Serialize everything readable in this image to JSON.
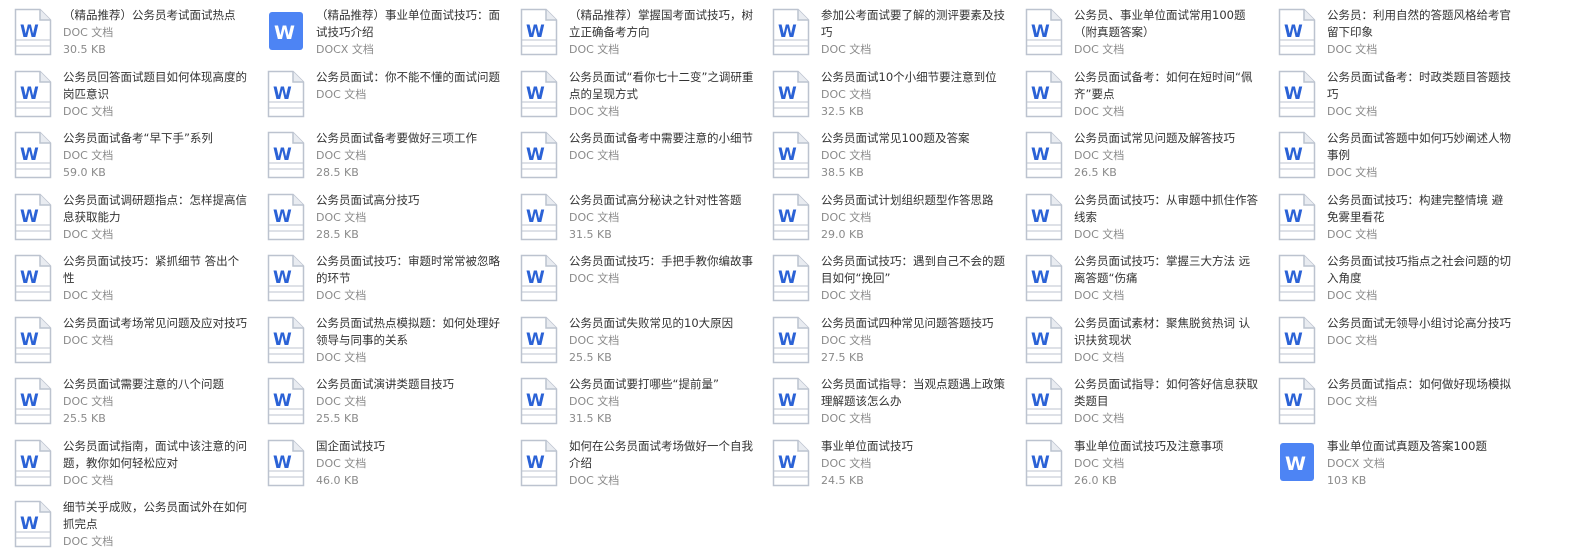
{
  "colors": {
    "doc_icon_outline": "#bcc3cf",
    "doc_icon_fold": "#e9ecf1",
    "doc_w_blue": "#2b62d6",
    "docx_icon_fill": "#4d84f4",
    "title_text": "#333333",
    "meta_text": "#8a8a8a"
  },
  "files": [
    {
      "title": "（精品推荐）公务员考试面试热点",
      "type": "DOC 文档",
      "size": "30.5 KB",
      "icon": "doc-icon"
    },
    {
      "title": "（精品推荐）事业单位面试技巧：面试技巧介绍",
      "type": "DOCX 文档",
      "size": "",
      "icon": "docx-icon"
    },
    {
      "title": "（精品推荐）掌握国考面试技巧，树立正确备考方向",
      "type": "DOC 文档",
      "size": "",
      "icon": "doc-icon"
    },
    {
      "title": "参加公考面试要了解的测评要素及技巧",
      "type": "DOC 文档",
      "size": "",
      "icon": "doc-icon"
    },
    {
      "title": "公务员、事业单位面试常用100题（附真题答案）",
      "type": "DOC 文档",
      "size": "",
      "icon": "doc-icon"
    },
    {
      "title": "公务员：利用自然的答题风格给考官留下印象",
      "type": "DOC 文档",
      "size": "",
      "icon": "doc-icon"
    },
    {
      "title": "公务员回答面试题目如何体现高度的岗匹意识",
      "type": "DOC 文档",
      "size": "",
      "icon": "doc-icon"
    },
    {
      "title": "公务员面试：你不能不懂的面试问题",
      "type": "DOC 文档",
      "size": "",
      "icon": "doc-icon"
    },
    {
      "title": "公务员面试“看你七十二变”之调研重点的呈现方式",
      "type": "DOC 文档",
      "size": "",
      "icon": "doc-icon"
    },
    {
      "title": "公务员面试10个小细节要注意到位",
      "type": "DOC 文档",
      "size": "32.5 KB",
      "icon": "doc-icon"
    },
    {
      "title": "公务员面试备考：如何在短时间“佩齐”要点",
      "type": "DOC 文档",
      "size": "",
      "icon": "doc-icon"
    },
    {
      "title": "公务员面试备考：时政类题目答题技巧",
      "type": "DOC 文档",
      "size": "",
      "icon": "doc-icon"
    },
    {
      "title": "公务员面试备考“早下手”系列",
      "type": "DOC 文档",
      "size": "59.0 KB",
      "icon": "doc-icon"
    },
    {
      "title": "公务员面试备考要做好三项工作",
      "type": "DOC 文档",
      "size": "28.5 KB",
      "icon": "doc-icon"
    },
    {
      "title": "公务员面试备考中需要注意的小细节",
      "type": "DOC 文档",
      "size": "",
      "icon": "doc-icon"
    },
    {
      "title": "公务员面试常见100题及答案",
      "type": "DOC 文档",
      "size": "38.5 KB",
      "icon": "doc-icon"
    },
    {
      "title": "公务员面试常见问题及解答技巧",
      "type": "DOC 文档",
      "size": "26.5 KB",
      "icon": "doc-icon"
    },
    {
      "title": "公务员面试答题中如何巧妙阐述人物事例",
      "type": "DOC 文档",
      "size": "",
      "icon": "doc-icon"
    },
    {
      "title": "公务员面试调研题指点：怎样提高信息获取能力",
      "type": "DOC 文档",
      "size": "",
      "icon": "doc-icon"
    },
    {
      "title": "公务员面试高分技巧",
      "type": "DOC 文档",
      "size": "28.5 KB",
      "icon": "doc-icon"
    },
    {
      "title": "公务员面试高分秘诀之针对性答题",
      "type": "DOC 文档",
      "size": "31.5 KB",
      "icon": "doc-icon"
    },
    {
      "title": "公务员面试计划组织题型作答思路",
      "type": "DOC 文档",
      "size": "29.0 KB",
      "icon": "doc-icon"
    },
    {
      "title": "公务员面试技巧：从审题中抓住作答线索",
      "type": "DOC 文档",
      "size": "",
      "icon": "doc-icon"
    },
    {
      "title": "公务员面试技巧：构建完整情境 避免雾里看花",
      "type": "DOC 文档",
      "size": "",
      "icon": "doc-icon"
    },
    {
      "title": "公务员面试技巧：紧抓细节 答出个性",
      "type": "DOC 文档",
      "size": "",
      "icon": "doc-icon"
    },
    {
      "title": "公务员面试技巧：审题时常常被忽略的环节",
      "type": "DOC 文档",
      "size": "",
      "icon": "doc-icon"
    },
    {
      "title": "公务员面试技巧：手把手教你编故事",
      "type": "DOC 文档",
      "size": "",
      "icon": "doc-icon"
    },
    {
      "title": "公务员面试技巧：遇到自己不会的题目如何“挽回”",
      "type": "DOC 文档",
      "size": "",
      "icon": "doc-icon"
    },
    {
      "title": "公务员面试技巧：掌握三大方法 远离答题“伤痛",
      "type": "DOC 文档",
      "size": "",
      "icon": "doc-icon"
    },
    {
      "title": "公务员面试技巧指点之社会问题的切入角度",
      "type": "DOC 文档",
      "size": "",
      "icon": "doc-icon"
    },
    {
      "title": "公务员面试考场常见问题及应对技巧",
      "type": "DOC 文档",
      "size": "",
      "icon": "doc-icon"
    },
    {
      "title": "公务员面试热点模拟题：如何处理好领导与同事的关系",
      "type": "DOC 文档",
      "size": "",
      "icon": "doc-icon"
    },
    {
      "title": "公务员面试失败常见的10大原因",
      "type": "DOC 文档",
      "size": "25.5 KB",
      "icon": "doc-icon"
    },
    {
      "title": "公务员面试四种常见问题答题技巧",
      "type": "DOC 文档",
      "size": "27.5 KB",
      "icon": "doc-icon"
    },
    {
      "title": "公务员面试素材：聚焦脱贫热词 认识扶贫现状",
      "type": "DOC 文档",
      "size": "",
      "icon": "doc-icon"
    },
    {
      "title": "公务员面试无领导小组讨论高分技巧",
      "type": "DOC 文档",
      "size": "",
      "icon": "doc-icon"
    },
    {
      "title": "公务员面试需要注意的八个问题",
      "type": "DOC 文档",
      "size": "25.5 KB",
      "icon": "doc-icon"
    },
    {
      "title": "公务员面试演讲类题目技巧",
      "type": "DOC 文档",
      "size": "25.5 KB",
      "icon": "doc-icon"
    },
    {
      "title": "公务员面试要打哪些“提前量”",
      "type": "DOC 文档",
      "size": "31.5 KB",
      "icon": "doc-icon"
    },
    {
      "title": "公务员面试指导：当观点题遇上政策理解题该怎么办",
      "type": "DOC 文档",
      "size": "",
      "icon": "doc-icon"
    },
    {
      "title": "公务员面试指导：如何答好信息获取类题目",
      "type": "DOC 文档",
      "size": "",
      "icon": "doc-icon"
    },
    {
      "title": "公务员面试指点：如何做好现场模拟",
      "type": "DOC 文档",
      "size": "",
      "icon": "doc-icon"
    },
    {
      "title": "公务员面试指南，面试中该注意的问题，教你如何轻松应对",
      "type": "DOC 文档",
      "size": "",
      "icon": "doc-icon"
    },
    {
      "title": "国企面试技巧",
      "type": "DOC 文档",
      "size": "46.0 KB",
      "icon": "doc-icon"
    },
    {
      "title": "如何在公务员面试考场做好一个自我介绍",
      "type": "DOC 文档",
      "size": "",
      "icon": "doc-icon"
    },
    {
      "title": "事业单位面试技巧",
      "type": "DOC 文档",
      "size": "24.5 KB",
      "icon": "doc-icon"
    },
    {
      "title": "事业单位面试技巧及注意事项",
      "type": "DOC 文档",
      "size": "26.0 KB",
      "icon": "doc-icon"
    },
    {
      "title": "事业单位面试真题及答案100题",
      "type": "DOCX 文档",
      "size": "103 KB",
      "icon": "docx-icon"
    },
    {
      "title": "细节关乎成败，公务员面试外在如何抓完点",
      "type": "DOC 文档",
      "size": "",
      "icon": "doc-icon"
    }
  ]
}
